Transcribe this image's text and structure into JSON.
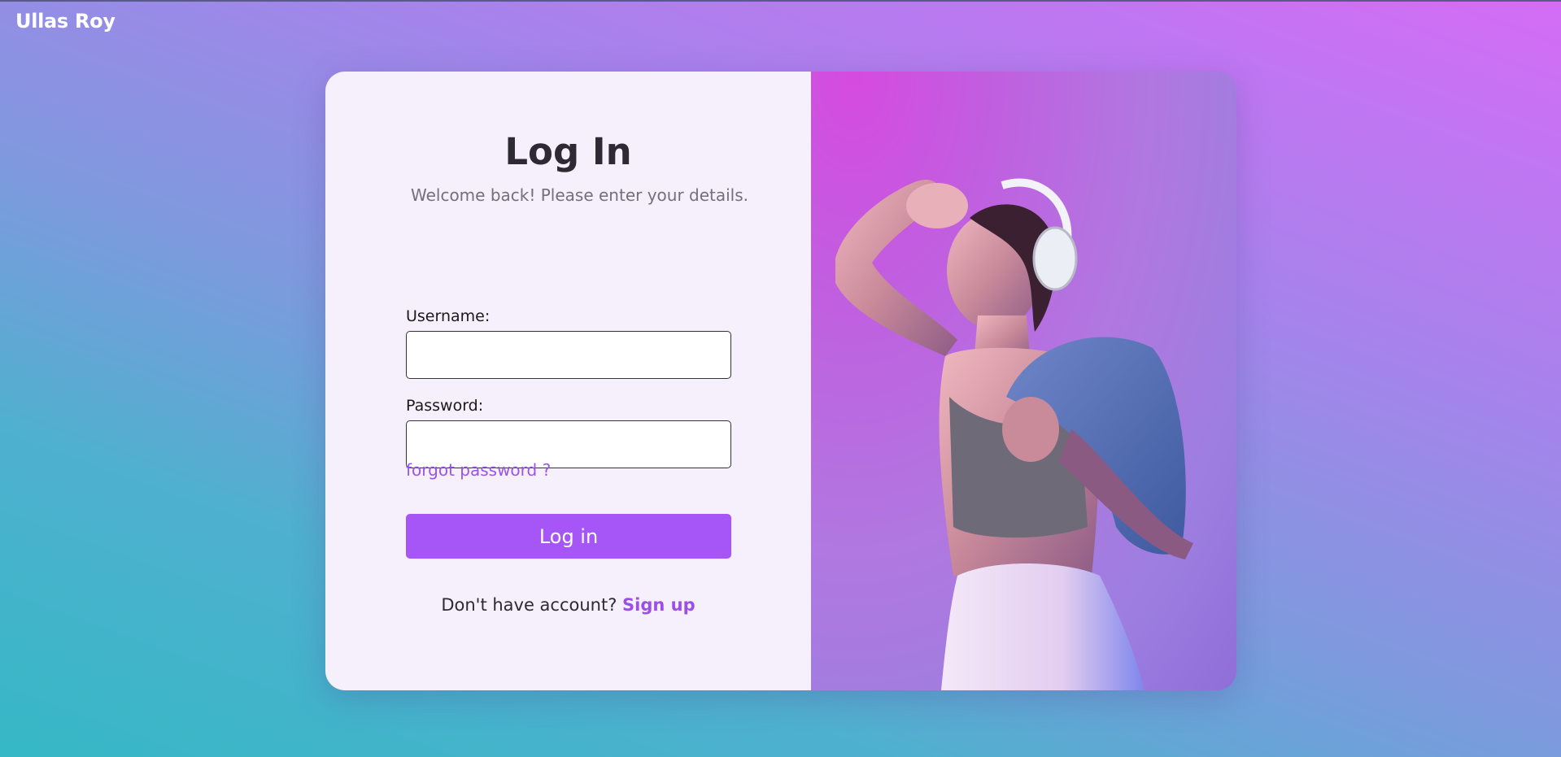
{
  "brand": {
    "name": "Ullas Roy"
  },
  "login": {
    "title": "Log In",
    "subtitle": "Welcome back! Please enter your details.",
    "username_label": "Username:",
    "username_value": "",
    "password_label": "Password:",
    "password_value": "",
    "forgot_link": "forgot password ?",
    "submit_label": "Log in",
    "signup_prompt": "Don't have account? ",
    "signup_link": "Sign up"
  },
  "hero": {
    "image_icon": "woman-with-headphones-illustration"
  },
  "colors": {
    "accent": "#a656f6",
    "link": "#9b55e6",
    "panel_bg": "#f6effc"
  }
}
